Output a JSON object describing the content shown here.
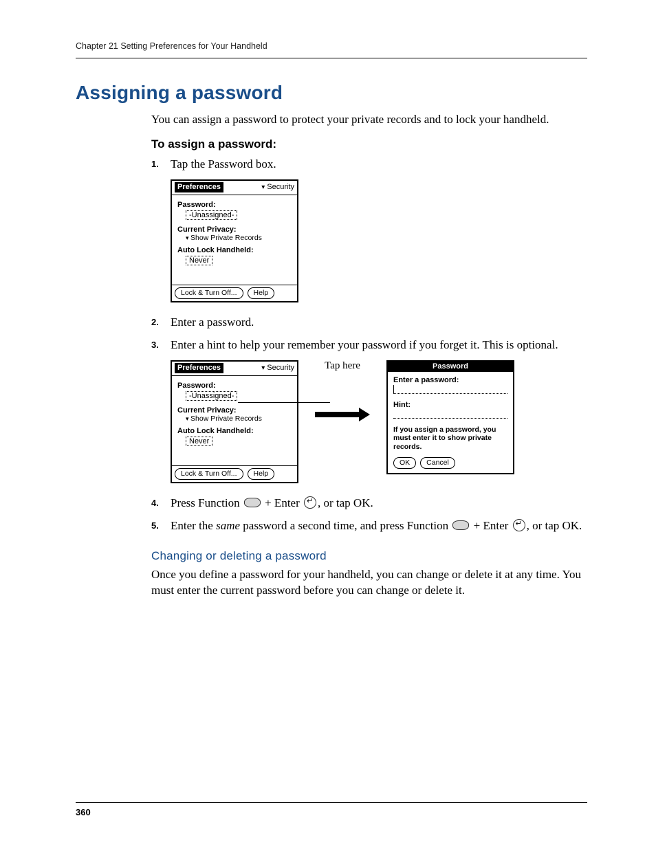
{
  "header": {
    "running_head": "Chapter 21   Setting Preferences for Your Handheld"
  },
  "section": {
    "title": "Assigning a password",
    "intro": "You can assign a password to protect your private records and to lock your handheld.",
    "procedure_title": "To assign a password:",
    "steps": {
      "s1": "Tap the Password box.",
      "s2": "Enter a password.",
      "s3": "Enter a hint to help your remember your password if you forget it. This is optional.",
      "s4_a": "Press Function ",
      "s4_b": " + Enter ",
      "s4_c": ", or tap OK.",
      "s5_a": "Enter the ",
      "s5_em": "same",
      "s5_b": " password a second time, and press Function ",
      "s5_c": " + Enter ",
      "s5_d": ", or tap OK."
    },
    "subsection_title": "Changing or deleting a password",
    "subsection_body": "Once you define a password for your handheld, you can change or delete it at any time. You must enter the current password before you can change or delete it."
  },
  "palm_prefs": {
    "title": "Preferences",
    "menu": "Security",
    "password_label": "Password:",
    "password_value": "-Unassigned-",
    "privacy_label": "Current Privacy:",
    "privacy_value": "Show Private Records",
    "autolock_label": "Auto Lock Handheld:",
    "autolock_value": "Never",
    "btn_lock": "Lock & Turn Off...",
    "btn_help": "Help"
  },
  "annotation": {
    "tap_here": "Tap here"
  },
  "palm_dialog": {
    "title": "Password",
    "enter_label": "Enter a password:",
    "hint_label": "Hint:",
    "note": "If you assign a password, you must enter it to show private records.",
    "btn_ok": "OK",
    "btn_cancel": "Cancel"
  },
  "page_number": "360"
}
